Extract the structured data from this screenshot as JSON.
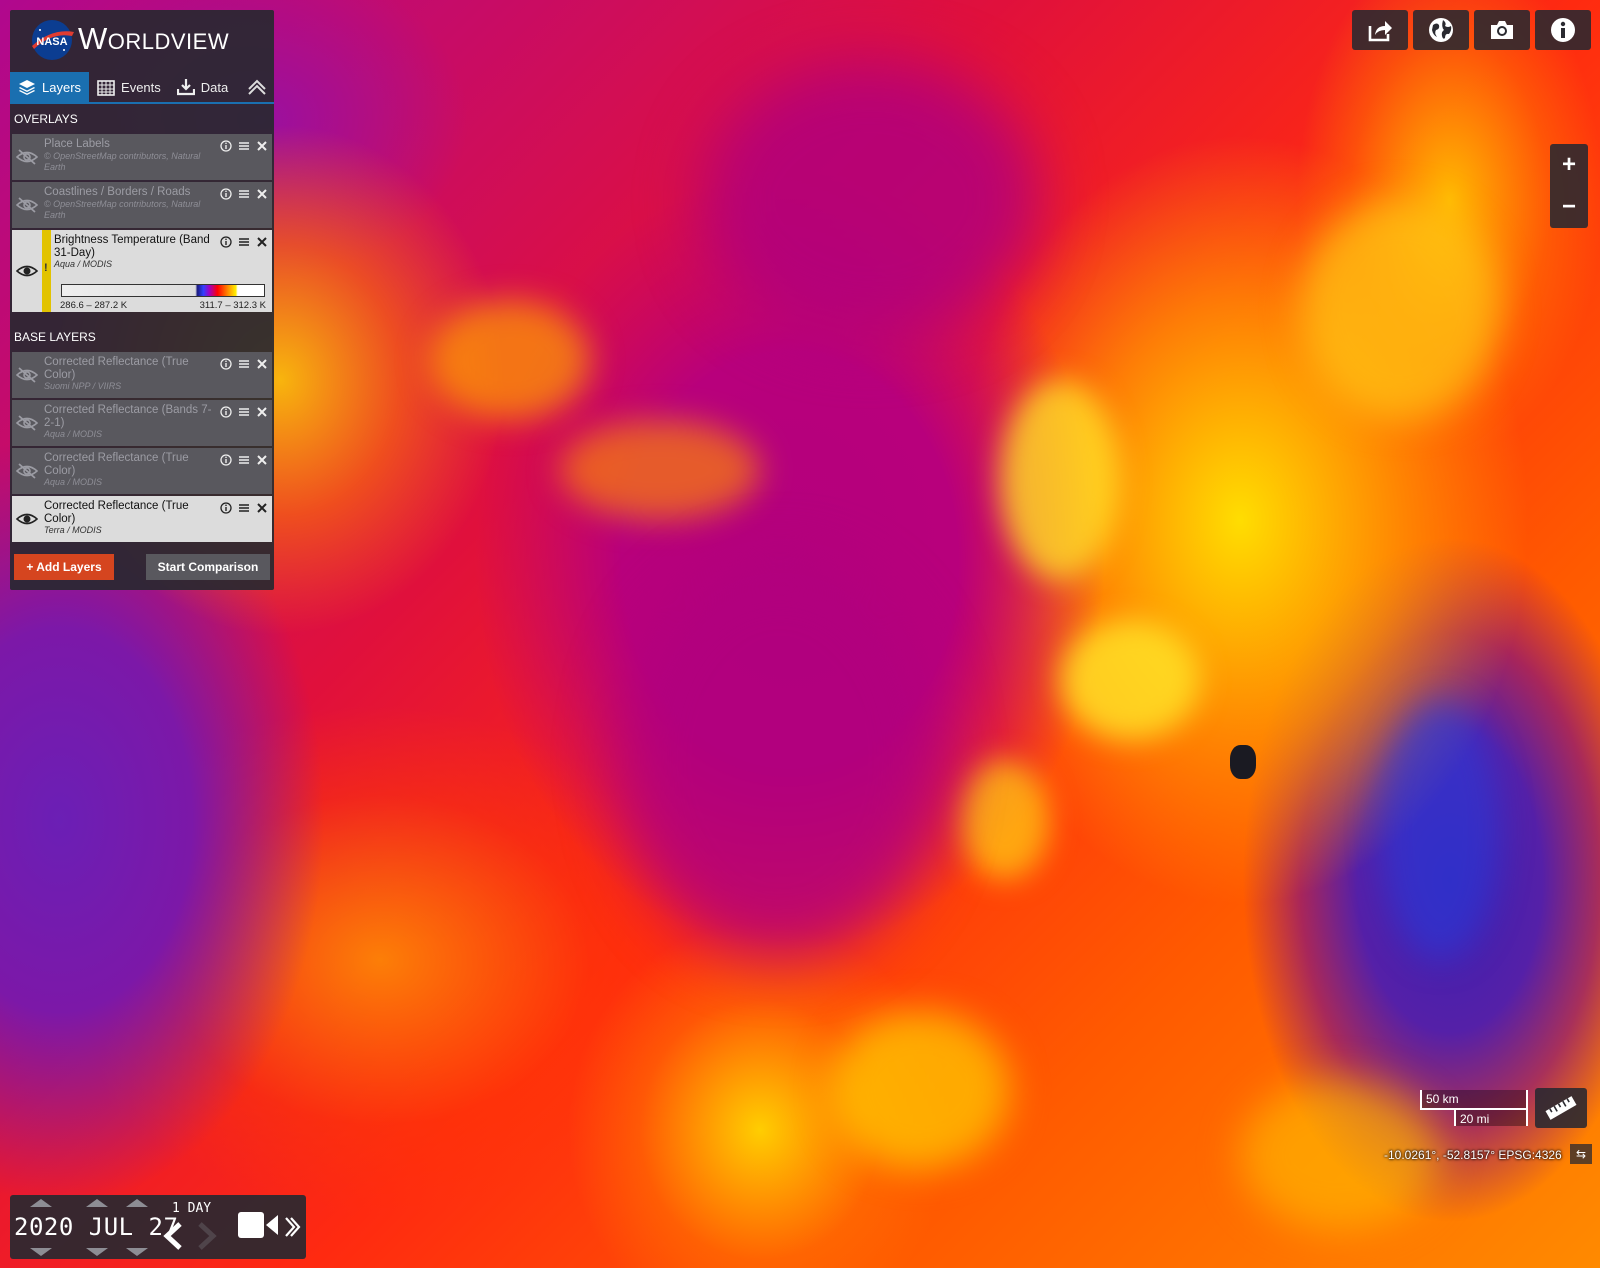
{
  "app": {
    "title": "Worldview",
    "logo_text": "NASA"
  },
  "tabs": [
    {
      "label": "Layers",
      "icon": "layers-icon",
      "active": true
    },
    {
      "label": "Events",
      "icon": "calendar-icon",
      "active": false
    },
    {
      "label": "Data",
      "icon": "download-icon",
      "active": false
    }
  ],
  "overlays": {
    "header": "OVERLAYS",
    "layers": [
      {
        "title": "Place Labels",
        "subtitle": "© OpenStreetMap contributors, Natural Earth",
        "visible": false
      },
      {
        "title": "Coastlines / Borders / Roads",
        "subtitle": "© OpenStreetMap contributors, Natural Earth",
        "visible": false
      },
      {
        "title": "Brightness Temperature (Band 31-Day)",
        "subtitle": "Aqua / MODIS",
        "visible": true,
        "warning": "!",
        "legend": {
          "min_label": "286.6 – 287.2 K",
          "max_label": "311.7 – 312.3 K"
        }
      }
    ]
  },
  "base_layers": {
    "header": "BASE LAYERS",
    "layers": [
      {
        "title": "Corrected Reflectance (True Color)",
        "subtitle": "Suomi NPP / VIIRS",
        "visible": false
      },
      {
        "title": "Corrected Reflectance (Bands 7-2-1)",
        "subtitle": "Aqua / MODIS",
        "visible": false
      },
      {
        "title": "Corrected Reflectance (True Color)",
        "subtitle": "Aqua / MODIS",
        "visible": false
      },
      {
        "title": "Corrected Reflectance (True Color)",
        "subtitle": "Terra / MODIS",
        "visible": true
      }
    ]
  },
  "buttons": {
    "add_layers": "+ Add Layers",
    "start_comparison": "Start Comparison"
  },
  "toolbar": {
    "share": "share-icon",
    "projection": "globe-icon",
    "snapshot": "camera-icon",
    "info": "info-icon"
  },
  "zoom": {
    "in": "+",
    "out": "−"
  },
  "scale": {
    "km": "50 km",
    "mi": "20 mi"
  },
  "coordinates": "-10.0261°, -52.8157° EPSG:4326",
  "timeline": {
    "date": "2020 JUL 27",
    "interval": "1 DAY"
  },
  "colors": {
    "accent": "#1a6fb0",
    "add_button": "#d5451f",
    "warning": "#e2c300"
  }
}
